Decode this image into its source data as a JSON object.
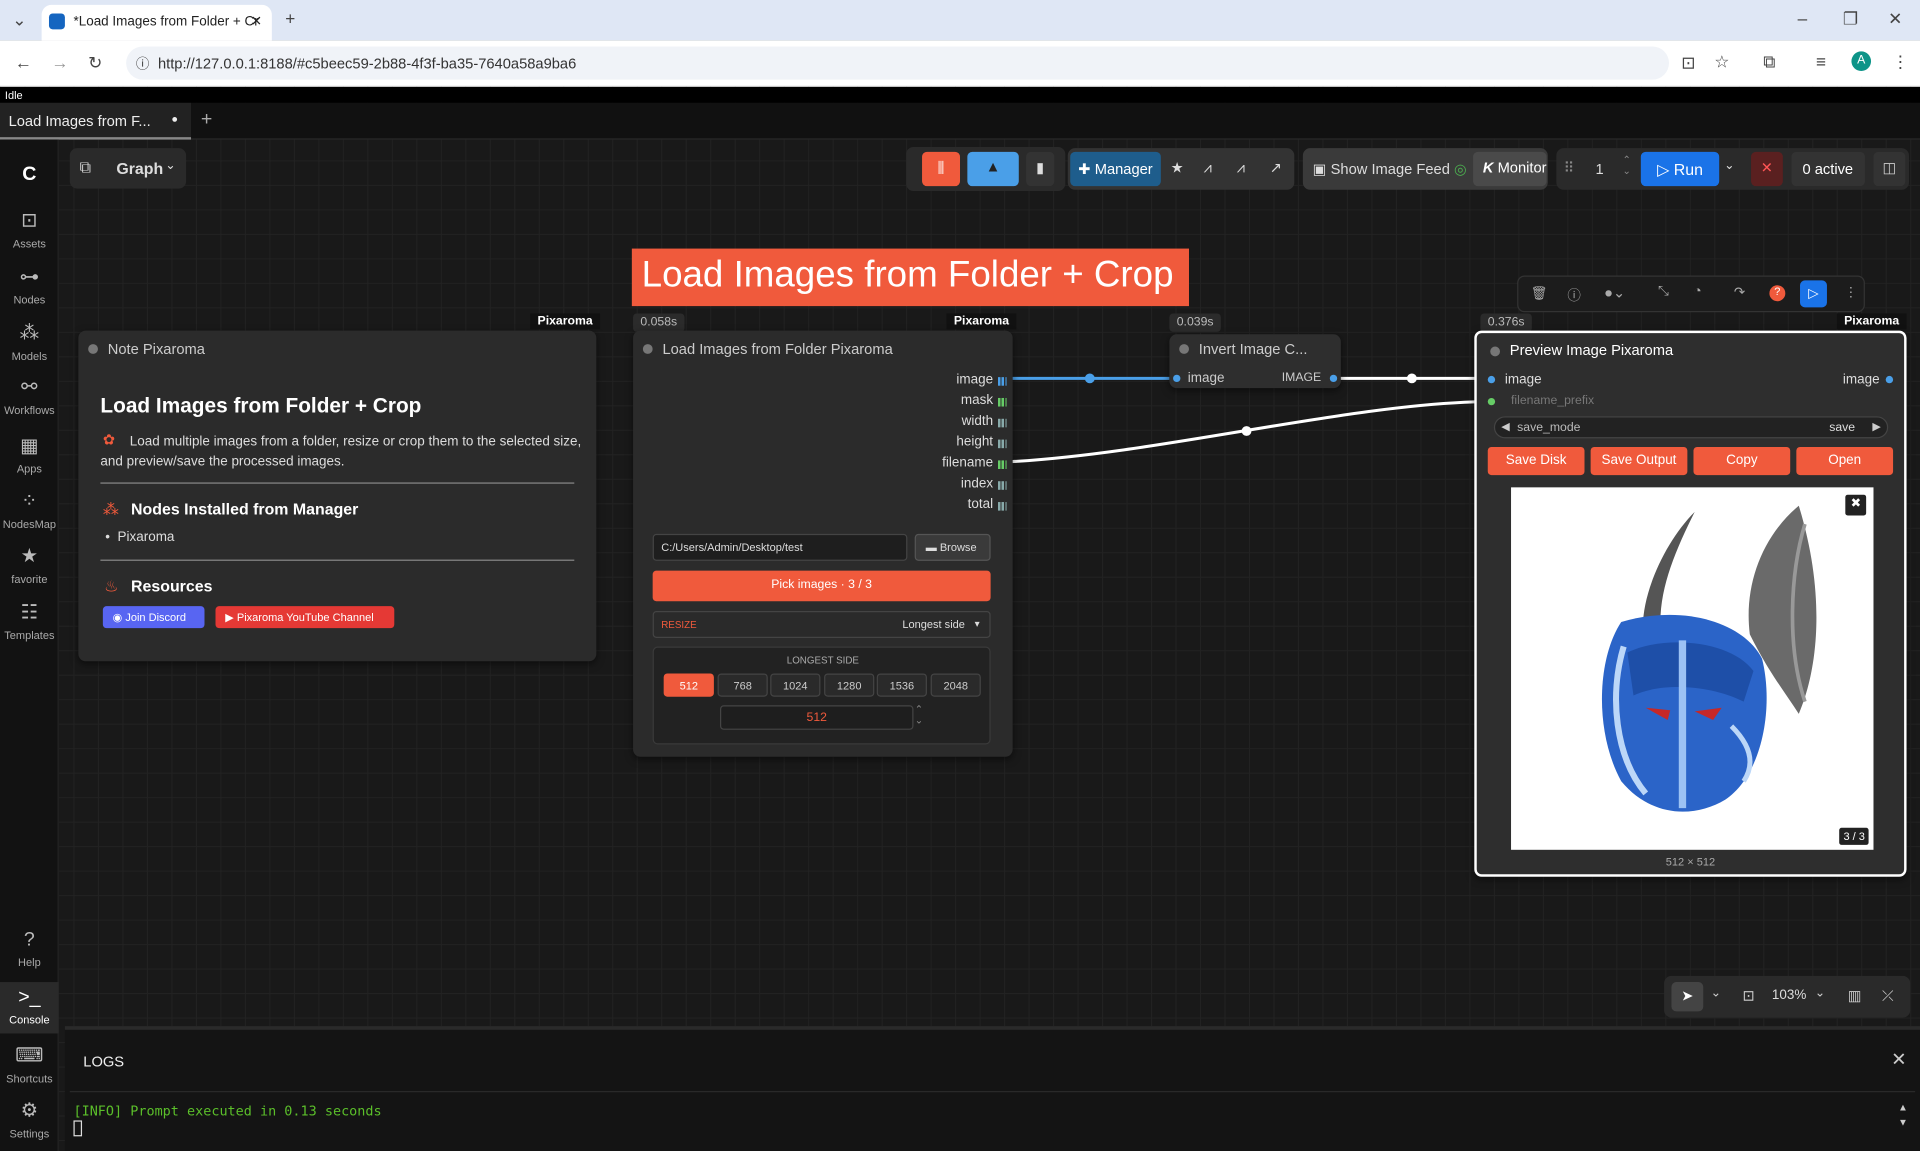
{
  "browser": {
    "tab_title": "*Load Images from Folder + Cr",
    "url": "http://127.0.0.1:8188/#c5beec59-2b88-4f3f-ba35-7640a58a9ba6"
  },
  "status": "Idle",
  "workflow_tab": "Load Images from F...",
  "graph_label": "Graph",
  "sidebar": [
    {
      "label": "Assets",
      "icon": "image-icon"
    },
    {
      "label": "Nodes",
      "icon": "nodes-icon"
    },
    {
      "label": "Models",
      "icon": "models-icon"
    },
    {
      "label": "Workflows",
      "icon": "workflows-icon"
    },
    {
      "label": "Apps",
      "icon": "apps-icon"
    },
    {
      "label": "NodesMap",
      "icon": "nodesmap-icon"
    },
    {
      "label": "favorite",
      "icon": "star-icon"
    },
    {
      "label": "Templates",
      "icon": "templates-icon"
    },
    {
      "label": "Help",
      "icon": "help-icon"
    },
    {
      "label": "Console",
      "icon": "console-icon"
    },
    {
      "label": "Shortcuts",
      "icon": "keyboard-icon"
    },
    {
      "label": "Settings",
      "icon": "gear-icon"
    }
  ],
  "toolbar": {
    "manager": "Manager",
    "show_feed": "Show Image Feed",
    "monitor": "Monitor",
    "batch": "1",
    "run": "Run",
    "active": "0 active"
  },
  "group_title": "Load Images from Folder + Crop",
  "note_node": {
    "badge": "Pixaroma",
    "title": "Note Pixaroma",
    "heading": "Load Images from Folder + Crop",
    "desc": "Load multiple images from a folder, resize or crop them to the selected size, and preview/save the processed images.",
    "section1": "Nodes Installed from Manager",
    "bullet": "Pixaroma",
    "section2": "Resources",
    "discord": "Join Discord",
    "youtube": "Pixaroma YouTube Channel"
  },
  "load_node": {
    "time": "0.058s",
    "badge": "Pixaroma",
    "title": "Load Images from Folder Pixaroma",
    "outputs": [
      "image",
      "mask",
      "width",
      "height",
      "filename",
      "index",
      "total"
    ],
    "path": "C:/Users/Admin/Desktop/test",
    "browse": "Browse",
    "pick": "Pick images · 3 / 3",
    "resize_label": "RESIZE",
    "resize_value": "Longest side",
    "longest_label": "LONGEST SIDE",
    "sizes": [
      "512",
      "768",
      "1024",
      "1280",
      "1536",
      "2048"
    ],
    "selected_size": "512",
    "value": "512"
  },
  "invert_node": {
    "time": "0.039s",
    "title": "Invert Image C...",
    "input": "image",
    "output": "IMAGE"
  },
  "preview_node": {
    "time": "0.376s",
    "badge": "Pixaroma",
    "title": "Preview Image Pixaroma",
    "input": "image",
    "output": "image",
    "filename_prefix": "filename_prefix",
    "save_mode_label": "save_mode",
    "save_mode_value": "save",
    "buttons": [
      "Save Disk",
      "Save Output",
      "Copy",
      "Open"
    ],
    "counter": "3 / 3",
    "dims": "512 × 512"
  },
  "canvas_controls": {
    "zoom": "103%"
  },
  "logs": {
    "title": "LOGS",
    "line": "[INFO] Prompt executed in 0.13 seconds"
  },
  "colors": {
    "accent": "#f05a3c",
    "link_blue": "#4a9fe8",
    "run_blue": "#1a73e8"
  }
}
